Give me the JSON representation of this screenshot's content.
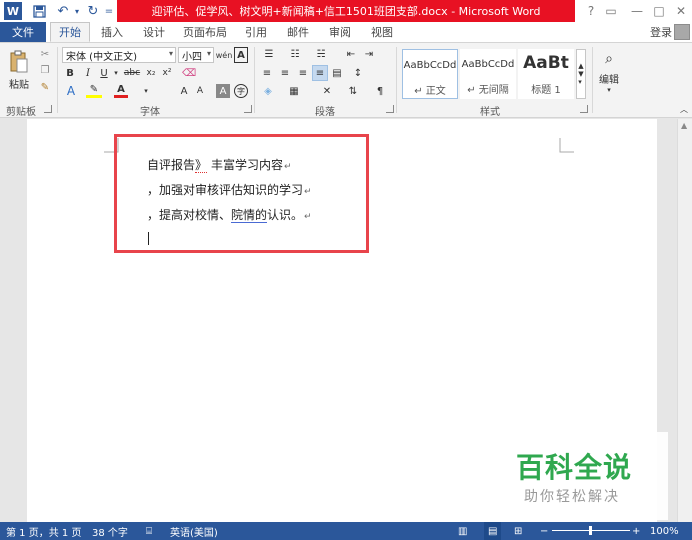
{
  "quick_access": {
    "app_letter": "W",
    "save_icon": "save-icon",
    "undo_glyph": "↶",
    "redo_glyph": "↻",
    "more_glyph": "="
  },
  "window": {
    "title": "迎评估、促学风、树文明+新闻稿+信工1501班团支部.docx -  Microsoft Word",
    "help": "?",
    "ribbon_toggle": "▭",
    "minimize": "—",
    "maximize": "□",
    "close": "✕"
  },
  "tabs": {
    "file": "文件",
    "items": [
      "开始",
      "插入",
      "设计",
      "页面布局",
      "引用",
      "邮件",
      "审阅",
      "视图"
    ],
    "login": "登录"
  },
  "ribbon": {
    "clipboard": {
      "paste": "粘贴",
      "label": "剪贴板"
    },
    "font": {
      "name": "宋体 (中文正文)",
      "size": "小四",
      "bold": "B",
      "italic": "I",
      "underline": "U",
      "strike": "abc",
      "sub": "x₂",
      "sup": "x²",
      "grow": "A",
      "shrink": "A",
      "clear": "A",
      "phonetic": "wén",
      "label": "字体"
    },
    "paragraph": {
      "label": "段落"
    },
    "styles": {
      "items": [
        {
          "sample": "AaBbCcDd",
          "name": "↵ 正文"
        },
        {
          "sample": "AaBbCcDd",
          "name": "↵ 无间隔"
        },
        {
          "sample": "AaBt",
          "name": "标题 1"
        }
      ],
      "label": "样式"
    },
    "editing": {
      "label": "编辑"
    }
  },
  "document": {
    "lines": [
      {
        "pre": "自评报告",
        "mark": "》",
        "post": "丰富学习内容"
      },
      {
        "pre": "，加强对审核评估知识的学习",
        "mark": "",
        "post": ""
      },
      {
        "pre": "，提高对校情、",
        "mark": "院情的",
        "post": "认识。"
      }
    ],
    "para_mark": "↵",
    "highlight_color": "#e8444b"
  },
  "status": {
    "page": "第 1 页，共 1 页",
    "words": "38 个字",
    "language": "英语(美国)",
    "zoom": "100%",
    "zoom_minus": "−",
    "zoom_plus": "+"
  },
  "watermark": {
    "title": "百科全说",
    "subtitle": "助你轻松解决"
  }
}
